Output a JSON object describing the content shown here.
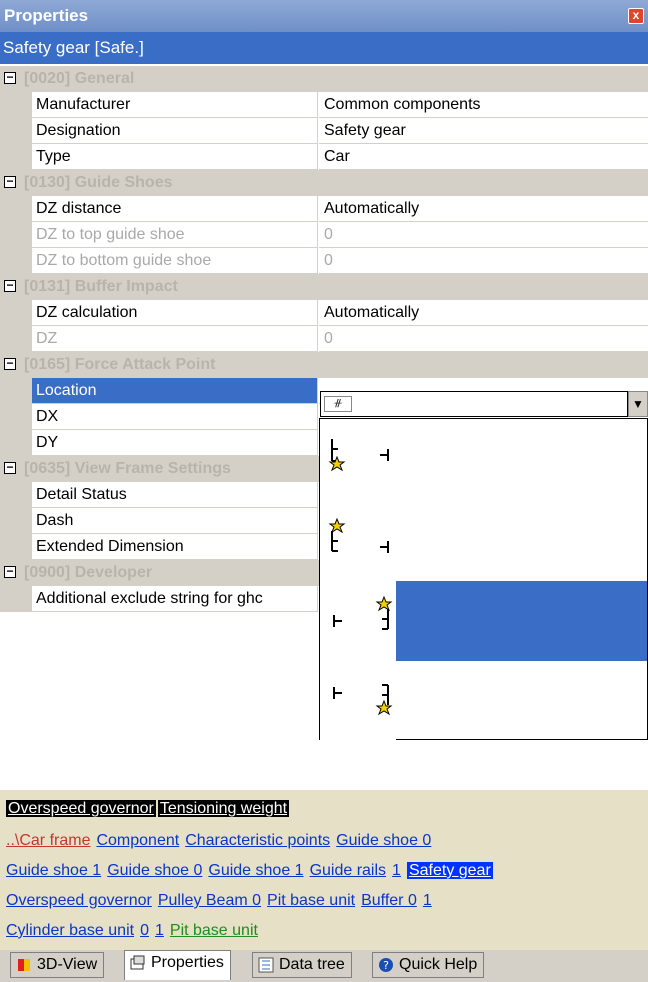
{
  "window": {
    "title": "Properties",
    "close_glyph": "x"
  },
  "object_header": "Safety gear [Safe.]",
  "sections": [
    {
      "title": "[0020] General",
      "rows": [
        {
          "name": "Manufacturer",
          "value": "Common components",
          "disabled": false
        },
        {
          "name": "Designation",
          "value": "Safety gear",
          "disabled": false
        },
        {
          "name": "Type",
          "value": "Car",
          "disabled": false
        }
      ]
    },
    {
      "title": "[0130] Guide Shoes",
      "rows": [
        {
          "name": "DZ distance",
          "value": "Automatically",
          "disabled": false
        },
        {
          "name": "DZ to top guide shoe",
          "value": "0",
          "disabled": true
        },
        {
          "name": "DZ to bottom guide shoe",
          "value": "0",
          "disabled": true
        }
      ]
    },
    {
      "title": "[0131] Buffer Impact",
      "rows": [
        {
          "name": "DZ calculation",
          "value": "Automatically",
          "disabled": false
        },
        {
          "name": "DZ",
          "value": "0",
          "disabled": true
        }
      ]
    },
    {
      "title": "[0165] Force Attack Point",
      "rows": [
        {
          "name": "Location",
          "value": "",
          "disabled": false,
          "selected": true
        },
        {
          "name": "DX",
          "value": "",
          "disabled": false
        },
        {
          "name": "DY",
          "value": "",
          "disabled": false
        }
      ]
    },
    {
      "title": "[0635] View Frame Settings",
      "rows": [
        {
          "name": "Detail Status",
          "value": "",
          "disabled": false
        },
        {
          "name": "Dash",
          "value": "",
          "disabled": false
        },
        {
          "name": "Extended Dimension",
          "value": "",
          "disabled": false
        }
      ]
    },
    {
      "title": "[0900] Developer",
      "rows": [
        {
          "name": "Additional exclude string for ghc",
          "value": "",
          "disabled": false
        }
      ]
    }
  ],
  "section_toggle_glyph": "⊟",
  "location_dropdown": {
    "selected_index": 2,
    "options": [
      "force-point-left-bottom-icon",
      "force-point-left-top-icon",
      "force-point-right-top-icon",
      "force-point-right-bottom-icon"
    ]
  },
  "breadcrumbs": [
    "Overspeed governor",
    "Tensioning weight"
  ],
  "nav_lines": [
    [
      {
        "text": "..\\Car frame",
        "style": "red"
      },
      {
        "text": "Component",
        "style": "link"
      },
      {
        "text": "Characteristic points",
        "style": "link"
      },
      {
        "text": "Guide shoe 0",
        "style": "link"
      }
    ],
    [
      {
        "text": "Guide shoe 1",
        "style": "link"
      },
      {
        "text": "Guide shoe 0",
        "style": "link"
      },
      {
        "text": "Guide shoe 1",
        "style": "link"
      },
      {
        "text": "Guide rails",
        "style": "link"
      },
      {
        "text": "1",
        "style": "link"
      },
      {
        "text": "Safety gear",
        "style": "sel"
      }
    ],
    [
      {
        "text": "Overspeed governor",
        "style": "link"
      },
      {
        "text": "Pulley Beam 0",
        "style": "link"
      },
      {
        "text": "Pit base unit",
        "style": "link"
      },
      {
        "text": "Buffer 0",
        "style": "link"
      },
      {
        "text": "1",
        "style": "link"
      }
    ],
    [
      {
        "text": "Cylinder base unit",
        "style": "link"
      },
      {
        "text": "0",
        "style": "link"
      },
      {
        "text": "1",
        "style": "link"
      },
      {
        "text": "Pit base unit",
        "style": "green"
      }
    ]
  ],
  "tabs": [
    {
      "label": "3D-View",
      "icon": "cube-icon",
      "active": false
    },
    {
      "label": "Properties",
      "icon": "properties-icon",
      "active": true
    },
    {
      "label": "Data tree",
      "icon": "data-tree-icon",
      "active": false
    },
    {
      "label": "Quick Help",
      "icon": "help-icon",
      "active": false
    }
  ],
  "colors": {
    "selection": "#3a6ec6",
    "link": "#0b35c8",
    "nav_bg": "#e6e1c6"
  }
}
